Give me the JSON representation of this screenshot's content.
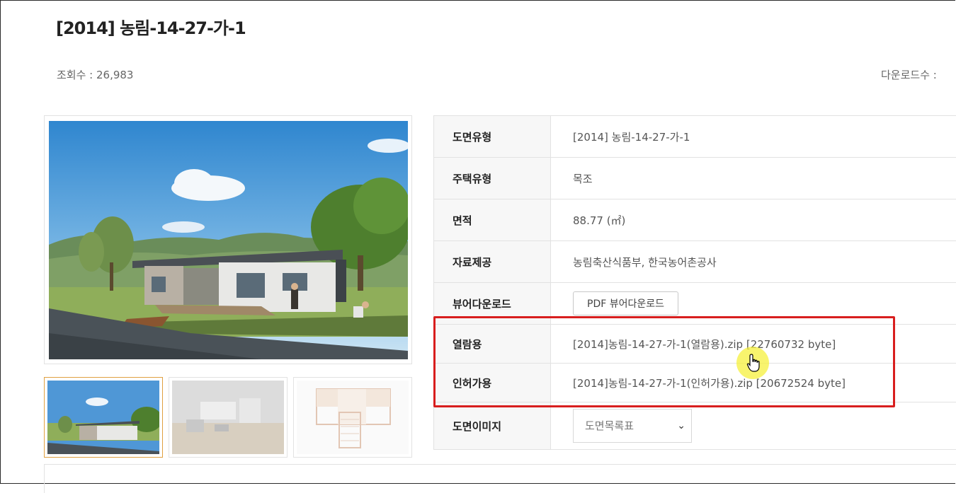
{
  "page": {
    "title": "[2014] 농림-14-27-가-1",
    "views": "조회수 : 26,983",
    "downloads": "다운로드수 :"
  },
  "info": {
    "rows": [
      {
        "key": "도면유형",
        "value": "[2014] 농림-14-27-가-1"
      },
      {
        "key": "주택유형",
        "value": "목조"
      },
      {
        "key": "면적",
        "value": "88.77 (㎡)"
      },
      {
        "key": "자료제공",
        "value": "농림축산식품부, 한국농어촌공사"
      },
      {
        "key": "뷰어다운로드",
        "button": "PDF 뷰어다운로드"
      },
      {
        "key": "열람용",
        "link": "[2014]농림-14-27-가-1(열람용).zip [22760732 byte]"
      },
      {
        "key": "인허가용",
        "link": "[2014]농림-14-27-가-1(인허가용).zip [20672524 byte]"
      },
      {
        "key": "도면이미지",
        "select": "도면목록표"
      }
    ]
  },
  "images": {
    "main": "house-rendering",
    "thumbs": [
      "house-exterior-thumb",
      "interior-thumb",
      "floor-plan-thumb"
    ]
  },
  "colors": {
    "highlight": "#d81e1e",
    "selected_thumb": "#e0a040",
    "cursor_glow": "#f5f03c"
  }
}
